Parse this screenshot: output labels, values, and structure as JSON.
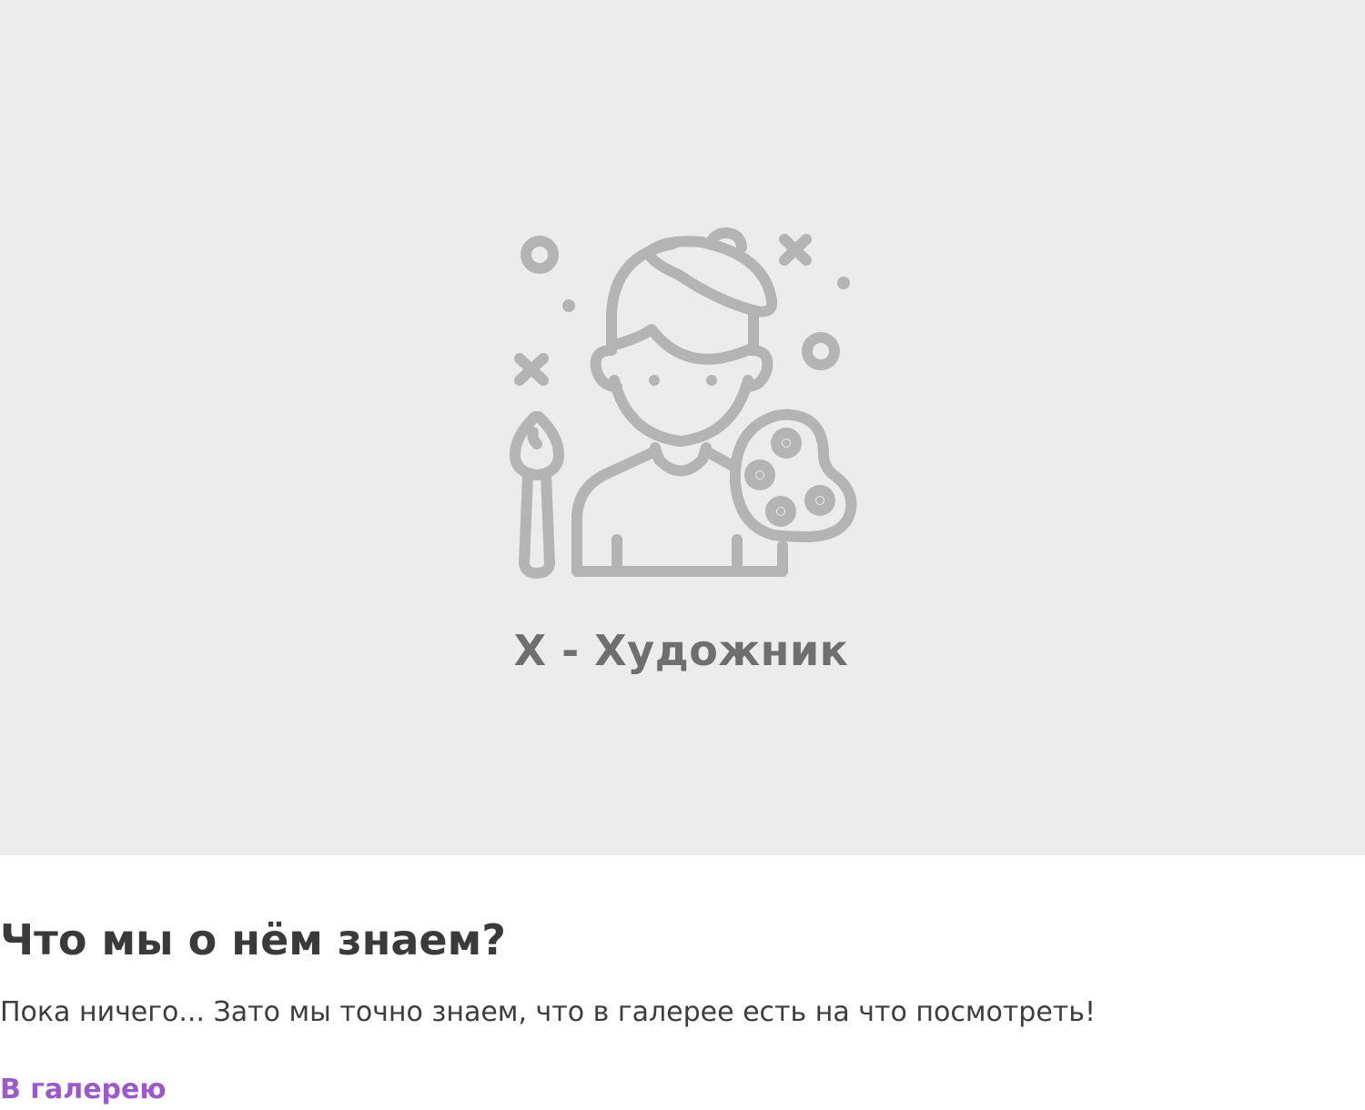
{
  "hero": {
    "illustration_icon": "artist-with-palette-icon",
    "caption": "Х - Художник"
  },
  "about": {
    "title": "Что мы о нём знаем?",
    "text": "Пока ничего... Зато мы точно знаем, что в галерее есть на что посмотреть!",
    "link_label": "В галерею"
  },
  "colors": {
    "hero_background": "#ececec",
    "icon_stroke": "#b4b4b4",
    "caption": "#6f6f6f",
    "title": "#3a3a3a",
    "link": "#9b59c9"
  }
}
